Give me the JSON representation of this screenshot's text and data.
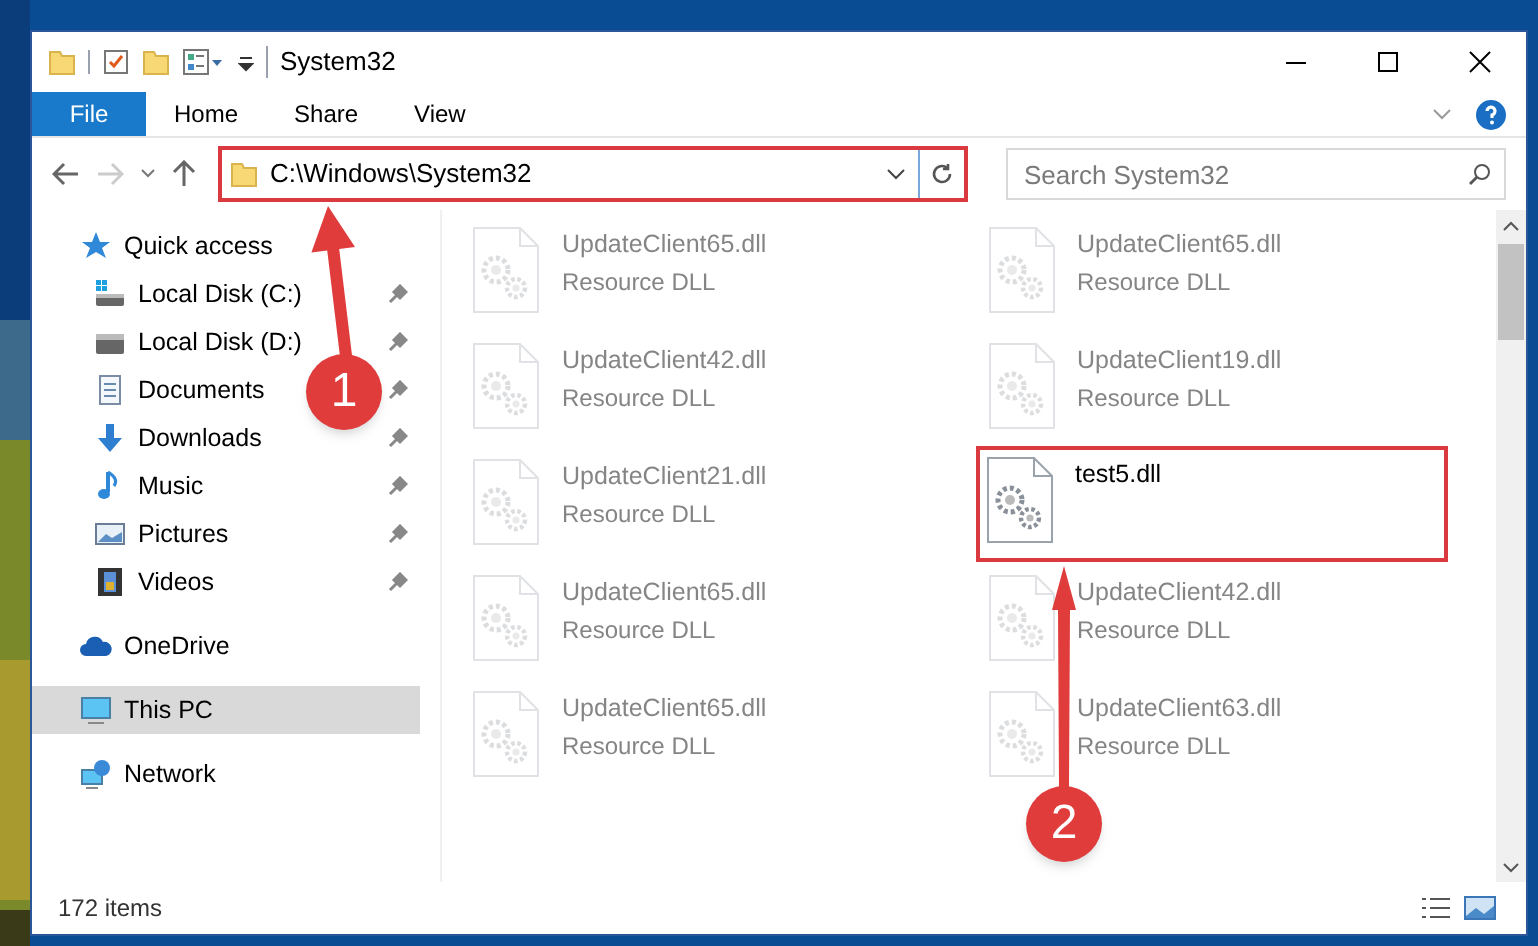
{
  "window": {
    "title": "System32"
  },
  "ribbon": {
    "tabs": [
      {
        "label": "File",
        "kind": "file"
      },
      {
        "label": "Home",
        "kind": "tab"
      },
      {
        "label": "Share",
        "kind": "tab"
      },
      {
        "label": "View",
        "kind": "tab"
      }
    ]
  },
  "address_bar": {
    "path": "C:\\Windows\\System32",
    "highlighted": true
  },
  "search": {
    "placeholder": "Search System32"
  },
  "sidebar": {
    "items": [
      {
        "label": "Quick access",
        "kind": "star",
        "selected": false,
        "children": [
          {
            "label": "Local Disk (C:)",
            "kind": "windrive",
            "pinned": true,
            "selected": false
          },
          {
            "label": "Local Disk (D:)",
            "kind": "drive",
            "pinned": true,
            "selected": false
          },
          {
            "label": "Documents",
            "kind": "document",
            "pinned": true,
            "selected": false
          },
          {
            "label": "Downloads",
            "kind": "download",
            "pinned": true,
            "selected": false
          },
          {
            "label": "Music",
            "kind": "music",
            "pinned": true,
            "selected": false
          },
          {
            "label": "Pictures",
            "kind": "pictures",
            "pinned": true,
            "selected": false
          },
          {
            "label": "Videos",
            "kind": "video",
            "pinned": true,
            "selected": false
          }
        ]
      },
      {
        "label": "OneDrive",
        "kind": "cloud",
        "selected": false
      },
      {
        "label": "This PC",
        "kind": "pc",
        "selected": true
      },
      {
        "label": "Network",
        "kind": "network",
        "selected": false
      }
    ]
  },
  "files": [
    {
      "name": "UpdateClient65.dll",
      "type": "Resource DLL",
      "faded": true,
      "highlighted": false
    },
    {
      "name": "UpdateClient65.dll",
      "type": "Resource DLL",
      "faded": true,
      "highlighted": false
    },
    {
      "name": "UpdateClient42.dll",
      "type": "Resource DLL",
      "faded": true,
      "highlighted": false
    },
    {
      "name": "UpdateClient19.dll",
      "type": "Resource DLL",
      "faded": true,
      "highlighted": false
    },
    {
      "name": "UpdateClient21.dll",
      "type": "Resource DLL",
      "faded": true,
      "highlighted": false
    },
    {
      "name": "test5.dll",
      "faded": false,
      "highlighted": true
    },
    {
      "name": "UpdateClient65.dll",
      "type": "Resource DLL",
      "faded": true,
      "highlighted": false
    },
    {
      "name": "UpdateClient42.dll",
      "type": "Resource DLL",
      "faded": true,
      "highlighted": false
    },
    {
      "name": "UpdateClient65.dll",
      "type": "Resource DLL",
      "faded": true,
      "highlighted": false
    },
    {
      "name": "UpdateClient63.dll",
      "type": "Resource DLL",
      "faded": true,
      "highlighted": false
    }
  ],
  "status_bar": {
    "item_count": "172 items"
  },
  "callouts": [
    {
      "number": "1"
    },
    {
      "number": "2"
    }
  ]
}
